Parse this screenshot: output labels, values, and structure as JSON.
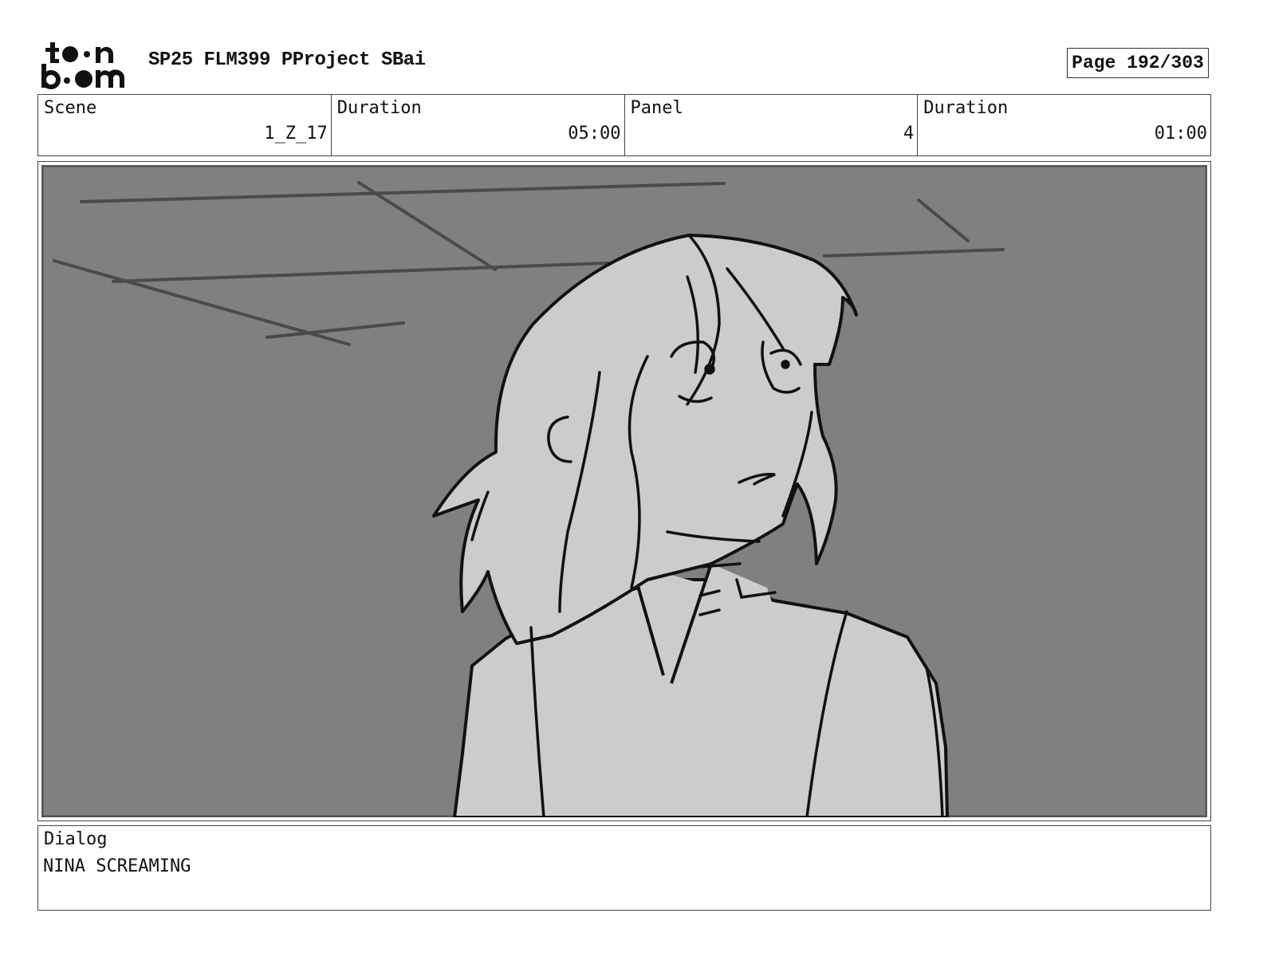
{
  "header": {
    "logo_text": "toon boom",
    "project_title": "SP25 FLM399 PProject SBai",
    "page_label": "Page 192/303"
  },
  "meta": {
    "scene_label": "Scene",
    "scene_value": "1_Z_17",
    "scene_duration_label": "Duration",
    "scene_duration_value": "05:00",
    "panel_label": "Panel",
    "panel_value": "4",
    "panel_duration_label": "Duration",
    "panel_duration_value": "01:00"
  },
  "dialog": {
    "label": "Dialog",
    "text": "NINA SCREAMING"
  },
  "colors": {
    "background_fill": "#808080",
    "figure_fill": "#cccccc",
    "line": "#111111"
  }
}
